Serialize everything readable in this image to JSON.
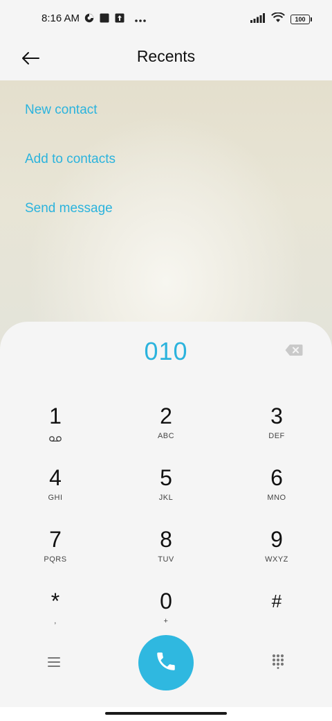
{
  "status_bar": {
    "time": "8:16 AM",
    "battery_level": "100",
    "icons": [
      "data-saver-icon",
      "square-notification-icon",
      "upload-icon",
      "more-notifications-icon",
      "signal-icon",
      "wifi-icon",
      "battery-icon"
    ]
  },
  "header": {
    "title": "Recents",
    "back_icon": "back-arrow-icon"
  },
  "actions": {
    "new_contact": "New contact",
    "add_to_contacts": "Add to contacts",
    "send_message": "Send message"
  },
  "dialpad": {
    "number": "010",
    "keys": [
      {
        "digit": "1",
        "letters": "",
        "icon": "voicemail-icon"
      },
      {
        "digit": "2",
        "letters": "ABC"
      },
      {
        "digit": "3",
        "letters": "DEF"
      },
      {
        "digit": "4",
        "letters": "GHI"
      },
      {
        "digit": "5",
        "letters": "JKL"
      },
      {
        "digit": "6",
        "letters": "MNO"
      },
      {
        "digit": "7",
        "letters": "PQRS"
      },
      {
        "digit": "8",
        "letters": "TUV"
      },
      {
        "digit": "9",
        "letters": "WXYZ"
      },
      {
        "digit": "*",
        "letters": ","
      },
      {
        "digit": "0",
        "letters": "+"
      },
      {
        "digit": "#",
        "letters": ""
      }
    ],
    "bottom_icons": [
      "menu-icon",
      "call-icon",
      "dialpad-toggle-icon"
    ]
  },
  "colors": {
    "accent": "#2bb3dd",
    "call_button": "#2fb8e0",
    "background": "#f5f5f5"
  }
}
